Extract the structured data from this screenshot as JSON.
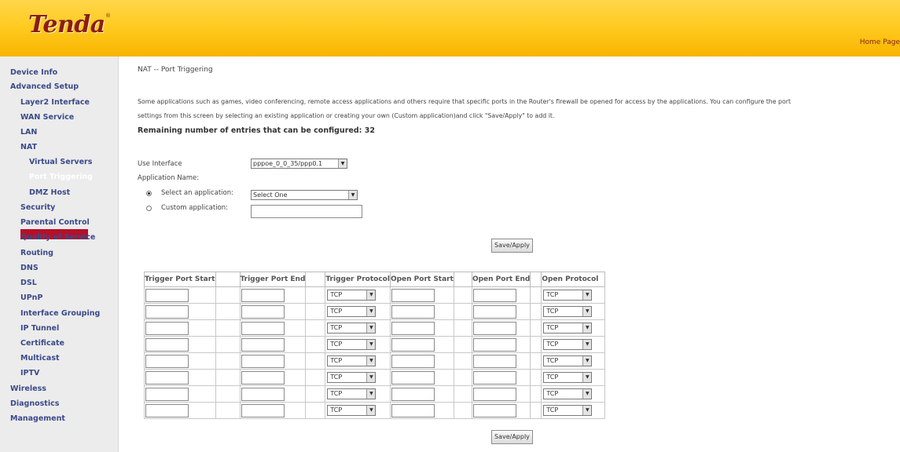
{
  "brand": {
    "logo": "Tenda",
    "reg": "®",
    "home_link": "Home Page"
  },
  "sidebar": {
    "items": [
      {
        "label": "Device Info"
      },
      {
        "label": "Advanced Setup"
      },
      {
        "label": "Layer2 Interface"
      },
      {
        "label": "WAN Service"
      },
      {
        "label": "LAN"
      },
      {
        "label": "NAT"
      },
      {
        "label": "Virtual Servers"
      },
      {
        "label": "Port Triggering"
      },
      {
        "label": "DMZ Host"
      },
      {
        "label": "Security"
      },
      {
        "label": "Parental Control"
      },
      {
        "label": "Quality of Service"
      },
      {
        "label": "Routing"
      },
      {
        "label": "DNS"
      },
      {
        "label": "DSL"
      },
      {
        "label": "UPnP"
      },
      {
        "label": "Interface Grouping"
      },
      {
        "label": "IP Tunnel"
      },
      {
        "label": "Certificate"
      },
      {
        "label": "Multicast"
      },
      {
        "label": "IPTV"
      },
      {
        "label": "Wireless"
      },
      {
        "label": "Diagnostics"
      },
      {
        "label": "Management"
      }
    ]
  },
  "page": {
    "title": "NAT -- Port Triggering",
    "desc_line1": "Some applications such as games, video conferencing, remote access applications and others require that specific ports in the Router's firewall be opened for access by the applications. You can configure the port",
    "desc_line2": "settings from this screen by selecting an existing application or creating your own (Custom application)and click \"Save/Apply\" to add it.",
    "remaining": "Remaining number of entries that can be configured: 32",
    "use_interface_label": "Use Interface",
    "use_interface_value": "pppoe_0_0_35/ppp0.1",
    "app_name_label": "Application Name:",
    "select_app_label": "Select an application:",
    "select_app_value": "Select One",
    "custom_app_label": "Custom application:",
    "custom_app_value": "",
    "save_label": "Save/Apply"
  },
  "table": {
    "headers": [
      "Trigger Port Start",
      "Trigger Port End",
      "Trigger Protocol",
      "Open Port Start",
      "Open Port End",
      "Open Protocol"
    ],
    "rows": [
      {
        "trigger_protocol": "TCP",
        "open_protocol": "TCP"
      },
      {
        "trigger_protocol": "TCP",
        "open_protocol": "TCP"
      },
      {
        "trigger_protocol": "TCP",
        "open_protocol": "TCP"
      },
      {
        "trigger_protocol": "TCP",
        "open_protocol": "TCP"
      },
      {
        "trigger_protocol": "TCP",
        "open_protocol": "TCP"
      },
      {
        "trigger_protocol": "TCP",
        "open_protocol": "TCP"
      },
      {
        "trigger_protocol": "TCP",
        "open_protocol": "TCP"
      },
      {
        "trigger_protocol": "TCP",
        "open_protocol": "TCP"
      }
    ]
  },
  "colors": {
    "header_yellow": "#ffcc22",
    "active_red": "#b5102a",
    "nav_blue": "#3a4a8a",
    "logo_red": "#8a1d12"
  }
}
